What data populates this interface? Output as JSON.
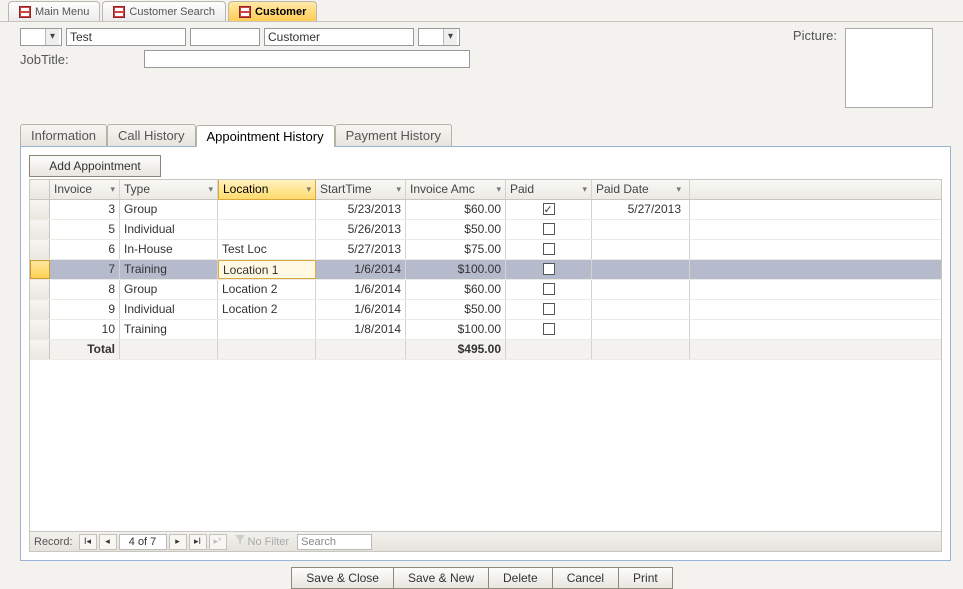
{
  "windowTabs": [
    {
      "label": "Main Menu",
      "active": false
    },
    {
      "label": "Customer Search",
      "active": false
    },
    {
      "label": "Customer",
      "active": true
    }
  ],
  "header": {
    "firstName": "Test",
    "middle": "",
    "lastName": "Customer",
    "jobTitleLabel": "JobTitle:",
    "jobTitleValue": "",
    "pictureLabel": "Picture:"
  },
  "mainTabs": {
    "items": [
      "Information",
      "Call History",
      "Appointment History",
      "Payment History"
    ],
    "activeIndex": 2
  },
  "addButton": "Add Appointment",
  "columns": [
    "Invoice",
    "Type",
    "Location",
    "StartTime",
    "Invoice Amc",
    "Paid",
    "Paid Date"
  ],
  "selectedColumnIndex": 2,
  "highlightedRowIndex": 3,
  "rows": [
    {
      "invoice": "3",
      "type": "Group",
      "location": "",
      "start": "5/23/2013",
      "amount": "$60.00",
      "paid": true,
      "paidDate": "5/27/2013"
    },
    {
      "invoice": "5",
      "type": "Individual",
      "location": "",
      "start": "5/26/2013",
      "amount": "$50.00",
      "paid": false,
      "paidDate": ""
    },
    {
      "invoice": "6",
      "type": "In-House",
      "location": "Test Loc",
      "start": "5/27/2013",
      "amount": "$75.00",
      "paid": false,
      "paidDate": ""
    },
    {
      "invoice": "7",
      "type": "Training",
      "location": "Location 1",
      "start": "1/6/2014",
      "amount": "$100.00",
      "paid": false,
      "paidDate": ""
    },
    {
      "invoice": "8",
      "type": "Group",
      "location": "Location 2",
      "start": "1/6/2014",
      "amount": "$60.00",
      "paid": false,
      "paidDate": ""
    },
    {
      "invoice": "9",
      "type": "Individual",
      "location": "Location 2",
      "start": "1/6/2014",
      "amount": "$50.00",
      "paid": false,
      "paidDate": ""
    },
    {
      "invoice": "10",
      "type": "Training",
      "location": "",
      "start": "1/8/2014",
      "amount": "$100.00",
      "paid": false,
      "paidDate": ""
    }
  ],
  "totalRow": {
    "label": "Total",
    "amount": "$495.00"
  },
  "recordNav": {
    "label": "Record:",
    "position": "4 of 7",
    "noFilter": "No Filter",
    "searchPlaceholder": "Search"
  },
  "footerButtons": [
    "Save & Close",
    "Save & New",
    "Delete",
    "Cancel",
    "Print"
  ]
}
